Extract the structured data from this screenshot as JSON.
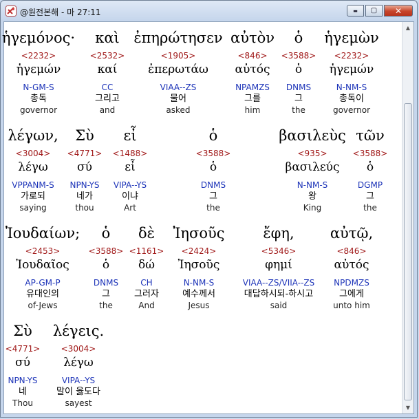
{
  "window": {
    "title": "@원전본해 - 마 27:11",
    "buttons": {
      "minimize": "▬",
      "maximize": "▢",
      "close": "✕"
    }
  },
  "rows": [
    {
      "words": [
        {
          "greek": "ἡγεμόνος·",
          "num": "<2232>",
          "lemma": "ἡγεμών",
          "parse": "N-GM-S",
          "kor": "총독",
          "eng": "governor"
        },
        {
          "greek": "καὶ",
          "num": "<2532>",
          "lemma": "καί",
          "parse": "CC",
          "kor": "그리고",
          "eng": "and"
        },
        {
          "greek": "ἐπηρώτησεν",
          "num": "<1905>",
          "lemma": "ἐπερωτάω",
          "parse": "VIAA--ZS",
          "kor": "물어",
          "eng": "asked"
        },
        {
          "greek": "αὐτὸν",
          "num": "<846>",
          "lemma": "αὐτός",
          "parse": "NPAMZS",
          "kor": "그를",
          "eng": "him"
        },
        {
          "greek": "ὁ",
          "num": "<3588>",
          "lemma": "ὁ",
          "parse": "DNMS",
          "kor": "그",
          "eng": "the"
        },
        {
          "greek": "ἡγεμὼν",
          "num": "<2232>",
          "lemma": "ἡγεμών",
          "parse": "N-NM-S",
          "kor": "총독이",
          "eng": "governor"
        }
      ]
    },
    {
      "words": [
        {
          "greek": "λέγων,",
          "num": "<3004>",
          "lemma": "λέγω",
          "parse": "VPPANM-S",
          "kor": "가로되",
          "eng": "saying"
        },
        {
          "greek": "Σὺ",
          "num": "<4771>",
          "lemma": "σύ",
          "parse": "NPN-YS",
          "kor": "네가",
          "eng": "thou"
        },
        {
          "greek": "εἶ",
          "num": "<1488>",
          "lemma": "εἶ",
          "parse": "VIPA--YS",
          "kor": "이냐",
          "eng": "Art"
        },
        {
          "greek": "ὁ",
          "num": "<3588>",
          "lemma": "ὁ",
          "parse": "DNMS",
          "kor": "그",
          "eng": "the"
        },
        {
          "greek": "βασιλεὺς",
          "num": "<935>",
          "lemma": "βασιλεύς",
          "parse": "N-NM-S",
          "kor": "왕",
          "eng": "King"
        },
        {
          "greek": "τῶν",
          "num": "<3588>",
          "lemma": "ὁ",
          "parse": "DGMP",
          "kor": "그",
          "eng": "the"
        }
      ]
    },
    {
      "words": [
        {
          "greek": "Ἰουδαίων;",
          "num": "<2453>",
          "lemma": "Ἰουδαῖος",
          "parse": "AP-GM-P",
          "kor": "유대인의",
          "eng": "of-Jews"
        },
        {
          "greek": "ὁ",
          "num": "<3588>",
          "lemma": "ὁ",
          "parse": "DNMS",
          "kor": "그",
          "eng": "the"
        },
        {
          "greek": "δὲ",
          "num": "<1161>",
          "lemma": "δώ",
          "parse": "CH",
          "kor": "그러자",
          "eng": "And"
        },
        {
          "greek": "Ἰησοῦς",
          "num": "<2424>",
          "lemma": "Ἰησοῦς",
          "parse": "N-NM-S",
          "kor": "예수께서",
          "eng": "Jesus"
        },
        {
          "greek": "ἔφη,",
          "num": "<5346>",
          "lemma": "φημί",
          "parse": "VIAA--ZS/VIIA--ZS",
          "kor": "대답하시되-하시고",
          "eng": "said"
        },
        {
          "greek": "αὐτῷ,",
          "num": "<846>",
          "lemma": "αὐτός",
          "parse": "NPDMZS",
          "kor": "그에게",
          "eng": "unto him"
        }
      ]
    },
    {
      "words": [
        {
          "greek": "Σὺ",
          "num": "<4771>",
          "lemma": "σύ",
          "parse": "NPN-YS",
          "kor": "네",
          "eng": "Thou"
        },
        {
          "greek": "λέγεις.",
          "num": "<3004>",
          "lemma": "λέγω",
          "parse": "VIPA--YS",
          "kor": "말이 옳도다",
          "eng": "sayest"
        }
      ]
    }
  ]
}
